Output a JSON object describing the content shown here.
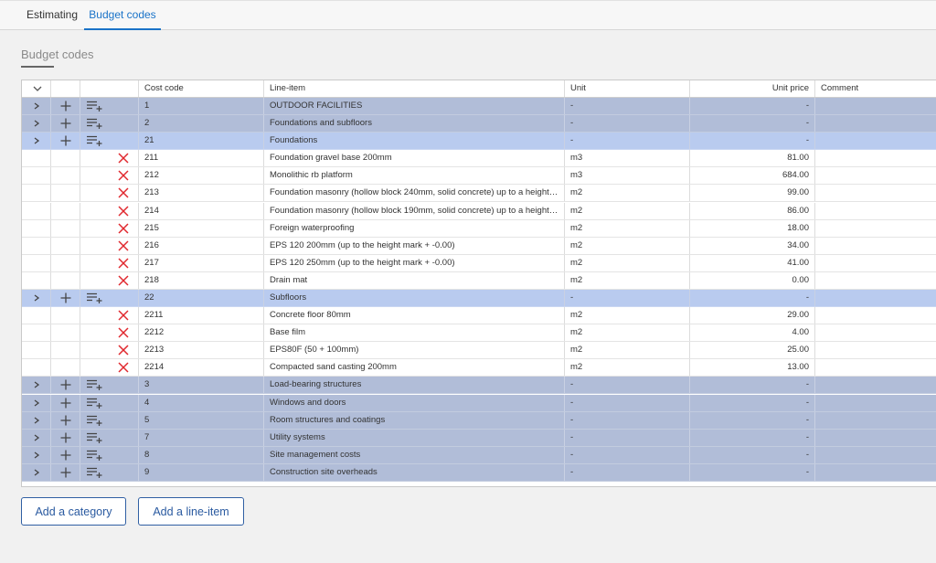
{
  "tabs": [
    {
      "label": "Estimating",
      "active": false
    },
    {
      "label": "Budget codes",
      "active": true
    }
  ],
  "section_title": "Budget codes",
  "columns": {
    "cost_code": "Cost code",
    "line_item": "Line-item",
    "unit": "Unit",
    "unit_price": "Unit price",
    "comment": "Comment"
  },
  "rows": [
    {
      "type": "category",
      "code": "1",
      "item": "OUTDOOR FACILITIES",
      "unit": "-",
      "price": "-",
      "comment": ""
    },
    {
      "type": "category",
      "code": "2",
      "item": "Foundations and subfloors",
      "unit": "-",
      "price": "-",
      "comment": ""
    },
    {
      "type": "category",
      "selected": true,
      "code": "21",
      "item": "Foundations",
      "unit": "-",
      "price": "-",
      "comment": ""
    },
    {
      "type": "line",
      "code": "211",
      "item": "Foundation gravel base 200mm",
      "unit": "m3",
      "price": "81.00",
      "comment": ""
    },
    {
      "type": "line",
      "code": "212",
      "item": "Monolithic rb platform",
      "unit": "m3",
      "price": "684.00",
      "comment": ""
    },
    {
      "type": "line",
      "code": "213",
      "item": "Foundation masonry (hollow block 240mm, solid concrete) up to a height m...",
      "unit": "m2",
      "price": "99.00",
      "comment": ""
    },
    {
      "type": "line",
      "code": "214",
      "item": "Foundation masonry (hollow block 190mm, solid concrete) up to a height m...",
      "unit": "m2",
      "price": "86.00",
      "comment": ""
    },
    {
      "type": "line",
      "code": "215",
      "item": "Foreign waterproofing",
      "unit": "m2",
      "price": "18.00",
      "comment": ""
    },
    {
      "type": "line",
      "code": "216",
      "item": "EPS 120 200mm (up to the height mark + -0.00)",
      "unit": "m2",
      "price": "34.00",
      "comment": ""
    },
    {
      "type": "line",
      "code": "217",
      "item": "EPS 120 250mm (up to the height mark + -0.00)",
      "unit": "m2",
      "price": "41.00",
      "comment": ""
    },
    {
      "type": "line",
      "code": "218",
      "item": "Drain mat",
      "unit": "m2",
      "price": "0.00",
      "comment": ""
    },
    {
      "type": "category",
      "selected": true,
      "code": "22",
      "item": "Subfloors",
      "unit": "-",
      "price": "-",
      "comment": ""
    },
    {
      "type": "line",
      "code": "2211",
      "item": "Concrete floor 80mm",
      "unit": "m2",
      "price": "29.00",
      "comment": ""
    },
    {
      "type": "line",
      "code": "2212",
      "item": "Base film",
      "unit": "m2",
      "price": "4.00",
      "comment": ""
    },
    {
      "type": "line",
      "code": "2213",
      "item": "EPS80F (50 + 100mm)",
      "unit": "m2",
      "price": "25.00",
      "comment": ""
    },
    {
      "type": "line",
      "code": "2214",
      "item": "Compacted sand casting 200mm",
      "unit": "m2",
      "price": "13.00",
      "comment": ""
    },
    {
      "type": "category",
      "code": "3",
      "item": "Load-bearing structures",
      "unit": "-",
      "price": "-",
      "comment": ""
    },
    {
      "type": "category",
      "code": "4",
      "item": "Windows and doors",
      "unit": "-",
      "price": "-",
      "comment": ""
    },
    {
      "type": "category",
      "code": "5",
      "item": "Room structures and coatings",
      "unit": "-",
      "price": "-",
      "comment": ""
    },
    {
      "type": "category",
      "code": "7",
      "item": "Utility systems",
      "unit": "-",
      "price": "-",
      "comment": ""
    },
    {
      "type": "category",
      "code": "8",
      "item": "Site management costs",
      "unit": "-",
      "price": "-",
      "comment": ""
    },
    {
      "type": "category",
      "code": "9",
      "item": "Construction site overheads",
      "unit": "-",
      "price": "-",
      "comment": ""
    }
  ],
  "buttons": {
    "add_category": "Add a category",
    "add_line_item": "Add a line-item"
  },
  "icons": {
    "expand_all": "chevron-down-icon",
    "expand_row": "chevron-right-icon",
    "add_subcategory": "plus-icon",
    "add_line_item": "playlist-add-icon",
    "delete": "close-icon"
  },
  "colors": {
    "accent": "#1a73c8",
    "category_row": "#b1bdd8",
    "selected_row": "#b9cbef",
    "delete_icon": "#e0282e",
    "button_border": "#2f5fa3"
  }
}
